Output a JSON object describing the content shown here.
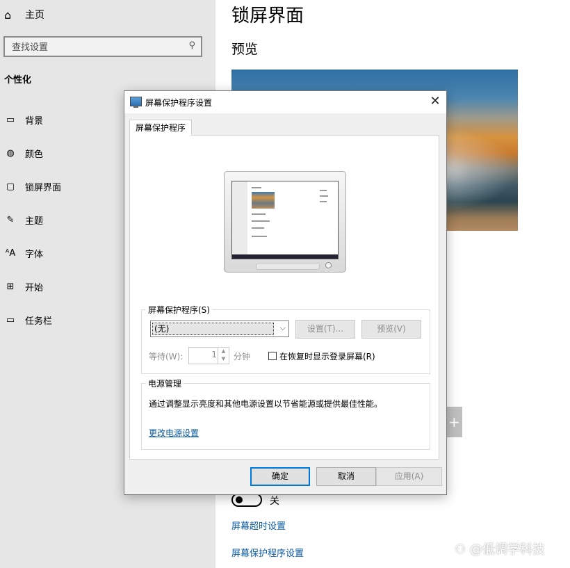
{
  "sidebar": {
    "home_label": "主页",
    "search_placeholder": "查找设置",
    "section_title": "个性化",
    "items": [
      {
        "label": "背景",
        "icon": "picture-icon"
      },
      {
        "label": "颜色",
        "icon": "palette-icon"
      },
      {
        "label": "锁屏界面",
        "icon": "lockscreen-icon"
      },
      {
        "label": "主题",
        "icon": "brush-icon"
      },
      {
        "label": "字体",
        "icon": "font-icon"
      },
      {
        "label": "开始",
        "icon": "start-icon"
      },
      {
        "label": "任务栏",
        "icon": "taskbar-icon"
      }
    ]
  },
  "main": {
    "title": "锁屏界面",
    "preview_label": "预览",
    "toggle_state": "关",
    "links": [
      "屏幕超时设置",
      "屏幕保护程序设置"
    ],
    "watermark": "⚇ @低调学科技"
  },
  "dialog": {
    "title": "屏幕保护程序设置",
    "close_glyph": "✕",
    "tab_label": "屏幕保护程序",
    "screensaver_group": {
      "legend": "屏幕保护程序(S)",
      "selected": "(无)",
      "settings_button": "设置(T)...",
      "preview_button": "预览(V)",
      "wait_label": "等待(W):",
      "wait_value": "1",
      "minutes_label": "分钟",
      "resume_checkbox_label": "在恢复时显示登录屏幕(R)",
      "resume_checked": false
    },
    "power_group": {
      "legend": "电源管理",
      "text": "通过调整显示亮度和其他电源设置以节省能源或提供最佳性能。",
      "link": "更改电源设置"
    },
    "buttons": {
      "ok": "确定",
      "cancel": "取消",
      "apply": "应用(A)"
    }
  },
  "colors": {
    "accent": "#0078d7",
    "link": "#0b5aa3",
    "sidebar_bg": "#e6e6e6",
    "dialog_bg": "#f0f0f0"
  }
}
